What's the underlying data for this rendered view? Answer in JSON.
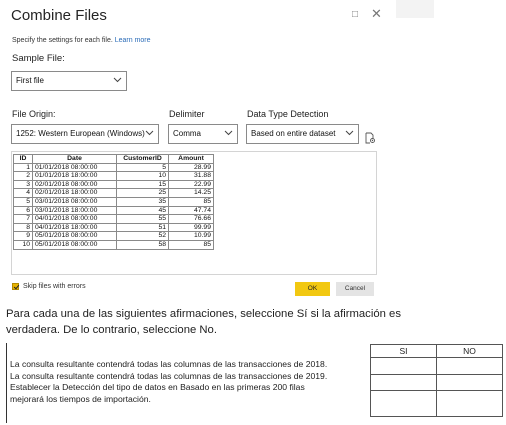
{
  "dialog": {
    "title": "Combine Files",
    "minimize_glyph": "□",
    "close_glyph": "✕",
    "subtitle": "Specify the settings for each file.",
    "learn_more": "Learn more",
    "sample_file_label": "Sample File:",
    "sample_file_value": "First file",
    "file_origin_label": "File Origin:",
    "file_origin_value": "1252: Western European (Windows)",
    "delimiter_label": "Delimiter",
    "delimiter_value": "Comma",
    "detection_label": "Data Type Detection",
    "detection_value": "Based on entire dataset",
    "settings_icon": "edit-settings-icon",
    "skip_label": "Skip files with errors",
    "ok_label": "OK",
    "cancel_label": "Cancel",
    "accent": "#f2c811"
  },
  "preview": {
    "columns": [
      "ID",
      "Date",
      "CustomerID",
      "Amount"
    ],
    "rows": [
      [
        "1",
        "01/01/2018 08:00:00",
        "5",
        "28.99"
      ],
      [
        "2",
        "01/01/2018 18:00:00",
        "10",
        "31.88"
      ],
      [
        "3",
        "02/01/2018 08:00:00",
        "15",
        "22.99"
      ],
      [
        "4",
        "02/01/2018 18:00:00",
        "25",
        "14.25"
      ],
      [
        "5",
        "03/01/2018 08:00:00",
        "35",
        "85"
      ],
      [
        "6",
        "03/01/2018 18:00:00",
        "45",
        "47.74"
      ],
      [
        "7",
        "04/01/2018 08:00:00",
        "55",
        "76.66"
      ],
      [
        "8",
        "04/01/2018 18:00:00",
        "51",
        "99.99"
      ],
      [
        "9",
        "05/01/2018 08:00:00",
        "52",
        "10.99"
      ],
      [
        "10",
        "05/01/2018 08:00:00",
        "58",
        "85"
      ]
    ]
  },
  "question": {
    "text": "Para cada una de las siguientes afirmaciones, seleccione Sí si la afirmación es verdadera. De lo contrario, seleccione No.",
    "statements": [
      "La consulta resultante contendrá todas las columnas de las transacciones de 2018.",
      "La consulta resultante contendrá todas las columnas de las transacciones de 2019.",
      "Establecer la Detección del tipo de datos en Basado en las primeras 200 filas",
      "mejorará los tiempos de importación."
    ],
    "answer_headers": [
      "SI",
      "NO"
    ]
  }
}
